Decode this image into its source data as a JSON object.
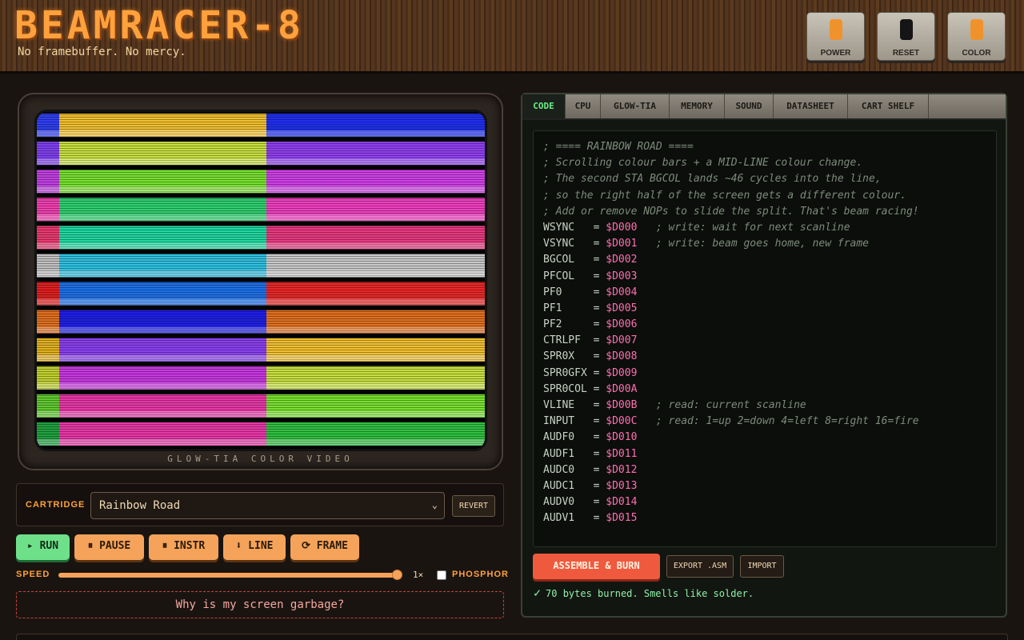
{
  "header": {
    "title": "BEAMRACER-8",
    "tagline": "No framebuffer. No mercy.",
    "buttons": [
      {
        "label": "POWER",
        "knob_color": "#f0922b"
      },
      {
        "label": "RESET",
        "knob_color": "#151515"
      },
      {
        "label": "COLOR",
        "knob_color": "#f0922b"
      }
    ]
  },
  "tv": {
    "label": "GLOW-TIA COLOR VIDEO"
  },
  "cartridge": {
    "label": "CARTRIDGE",
    "selected": "Rainbow Road",
    "revert_label": "REVERT"
  },
  "controls": {
    "run": "▸ RUN",
    "pause": "⏸ PAUSE",
    "instr": "⏸ INSTR",
    "line": "⬇ LINE",
    "frame": "⟳ FRAME",
    "speed_label": "SPEED",
    "speed_value": "1×",
    "speed_fraction": 1.0,
    "phosphor_label": "PHOSPHOR",
    "phosphor_checked": false
  },
  "help_button": "Why is my screen garbage?",
  "tabs": [
    "CODE",
    "CPU",
    "GLOW-TIA",
    "MEMORY",
    "SOUND",
    "DATASHEET",
    "CART SHELF"
  ],
  "active_tab": "CODE",
  "code": {
    "lines": [
      {
        "comment": "; ==== RAINBOW ROAD ===="
      },
      {
        "comment": "; Scrolling colour bars + a MID-LINE colour change."
      },
      {
        "comment": "; The second STA BGCOL lands ~46 cycles into the line,"
      },
      {
        "comment": "; so the right half of the screen gets a different colour."
      },
      {
        "comment": "; Add or remove NOPs to slide the split. That's beam racing!"
      },
      {
        "label": "WSYNC   = ",
        "hex": "$D000",
        "comment": "   ; write: wait for next scanline"
      },
      {
        "label": "VSYNC   = ",
        "hex": "$D001",
        "comment": "   ; write: beam goes home, new frame"
      },
      {
        "label": "BGCOL   = ",
        "hex": "$D002"
      },
      {
        "label": "PFCOL   = ",
        "hex": "$D003"
      },
      {
        "label": "PF0     = ",
        "hex": "$D004"
      },
      {
        "label": "PF1     = ",
        "hex": "$D005"
      },
      {
        "label": "PF2     = ",
        "hex": "$D006"
      },
      {
        "label": "CTRLPF  = ",
        "hex": "$D007"
      },
      {
        "label": "SPR0X   = ",
        "hex": "$D008"
      },
      {
        "label": "SPR0GFX = ",
        "hex": "$D009"
      },
      {
        "label": "SPR0COL = ",
        "hex": "$D00A"
      },
      {
        "label": "VLINE   = ",
        "hex": "$D00B",
        "comment": "   ; read: current scanline"
      },
      {
        "label": "INPUT   = ",
        "hex": "$D00C",
        "comment": "   ; read: 1=up 2=down 4=left 8=right 16=fire"
      },
      {
        "label": "AUDF0   = ",
        "hex": "$D010"
      },
      {
        "label": "AUDF1   = ",
        "hex": "$D011"
      },
      {
        "label": "AUDC0   = ",
        "hex": "$D012"
      },
      {
        "label": "AUDC1   = ",
        "hex": "$D013"
      },
      {
        "label": "AUDV0   = ",
        "hex": "$D014"
      },
      {
        "label": "AUDV1   = ",
        "hex": "$D015"
      }
    ]
  },
  "actions": {
    "assemble": "ASSEMBLE & BURN",
    "export": "EXPORT .ASM",
    "import": "IMPORT"
  },
  "status": {
    "icon": "✓",
    "text": "70 bytes burned. Smells like solder."
  },
  "screen_bands": {
    "left_colors": [
      "#f0c030",
      "#c8e040",
      "#78e030",
      "#30d070",
      "#20d8a0",
      "#30c0e0",
      "#1e70e8",
      "#2020e8",
      "#8a40f0",
      "#c838e0",
      "#e838a8"
    ],
    "right_colors": [
      "#2030f0",
      "#9040f0",
      "#d040e8",
      "#f040c0",
      "#e83a80",
      "#c8c8c8",
      "#e82828",
      "#e07020",
      "#f0c030",
      "#c8e040",
      "#78e030",
      "#30c040"
    ],
    "edge_colors": [
      "#3040f0",
      "#8040f0",
      "#c040e0",
      "#f040b0",
      "#e83a70",
      "#c0c0c0",
      "#e02020",
      "#e07020",
      "#e0b020",
      "#c0d030",
      "#60c830",
      "#20a040"
    ]
  }
}
